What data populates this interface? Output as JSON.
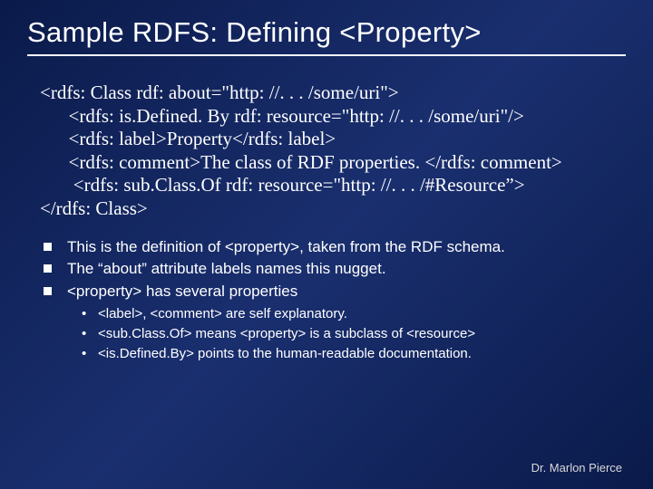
{
  "title": "Sample RDFS: Defining <Property>",
  "code": {
    "l1": "<rdfs: Class rdf: about=\"http: //. . . /some/uri\">",
    "l2": "      <rdfs: is.Defined. By rdf: resource=\"http: //. . . /some/uri\"/>",
    "l3": "      <rdfs: label>Property</rdfs: label>",
    "l4": "      <rdfs: comment>The class of RDF properties. </rdfs: comment>",
    "l5": "       <rdfs: sub.Class.Of rdf: resource=\"http: //. . . /#Resource”>",
    "l6": "</rdfs: Class>"
  },
  "bullets": {
    "b1": "This is the definition of <property>, taken from the RDF schema.",
    "b2": "The “about” attribute labels names this nugget.",
    "b3": "<property> has several properties"
  },
  "subbullets": {
    "s1": "<label>, <comment> are self explanatory.",
    "s2": "<sub.Class.Of> means <property> is a subclass of <resource>",
    "s3": "<is.Defined.By> points to the human-readable documentation."
  },
  "footer": "Dr. Marlon Pierce"
}
